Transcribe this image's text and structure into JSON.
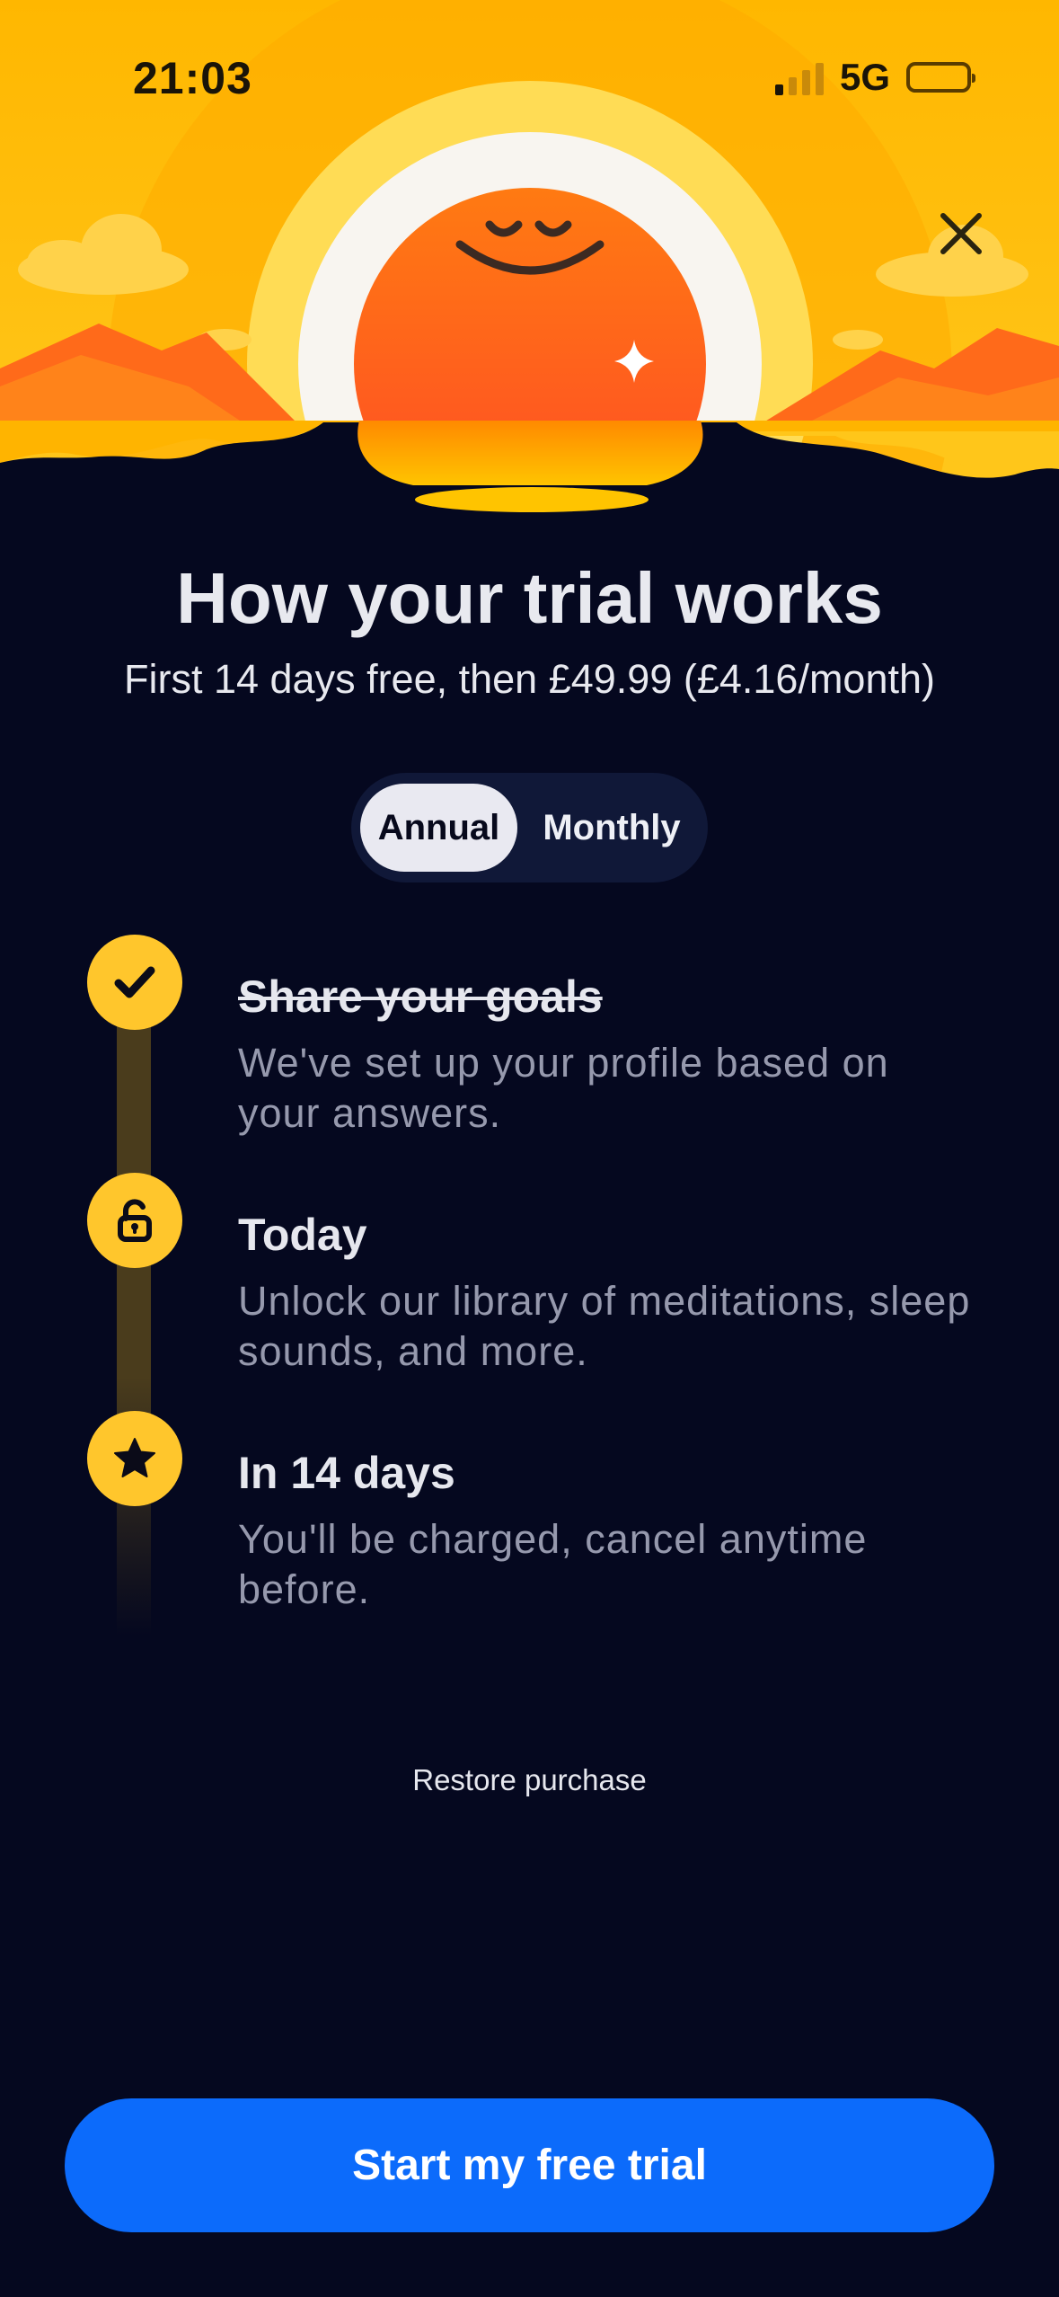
{
  "status_bar": {
    "time": "21:03",
    "network": "5G"
  },
  "icons": {
    "close": "close-icon",
    "step1": "checkmark-icon",
    "step2": "unlock-icon",
    "step3": "star-icon"
  },
  "colors": {
    "background": "#05081f",
    "accent_yellow": "#ffc62c",
    "cta_blue": "#0c6bfb",
    "sun_orange": "#ff6a1a"
  },
  "header": {
    "title": "How your trial works",
    "subtitle": "First 14 days free, then £49.99 (£4.16/month)"
  },
  "plan_toggle": {
    "options": [
      "Annual",
      "Monthly"
    ],
    "selected": "Annual"
  },
  "steps": [
    {
      "title": "Share your goals",
      "description": "We've set up your profile based on your answers."
    },
    {
      "title": "Today",
      "description": "Unlock our library of meditations, sleep sounds, and more."
    },
    {
      "title": "In 14 days",
      "description": "You'll be charged, cancel anytime before."
    }
  ],
  "restore_label": "Restore purchase",
  "cta_label": "Start my free trial"
}
